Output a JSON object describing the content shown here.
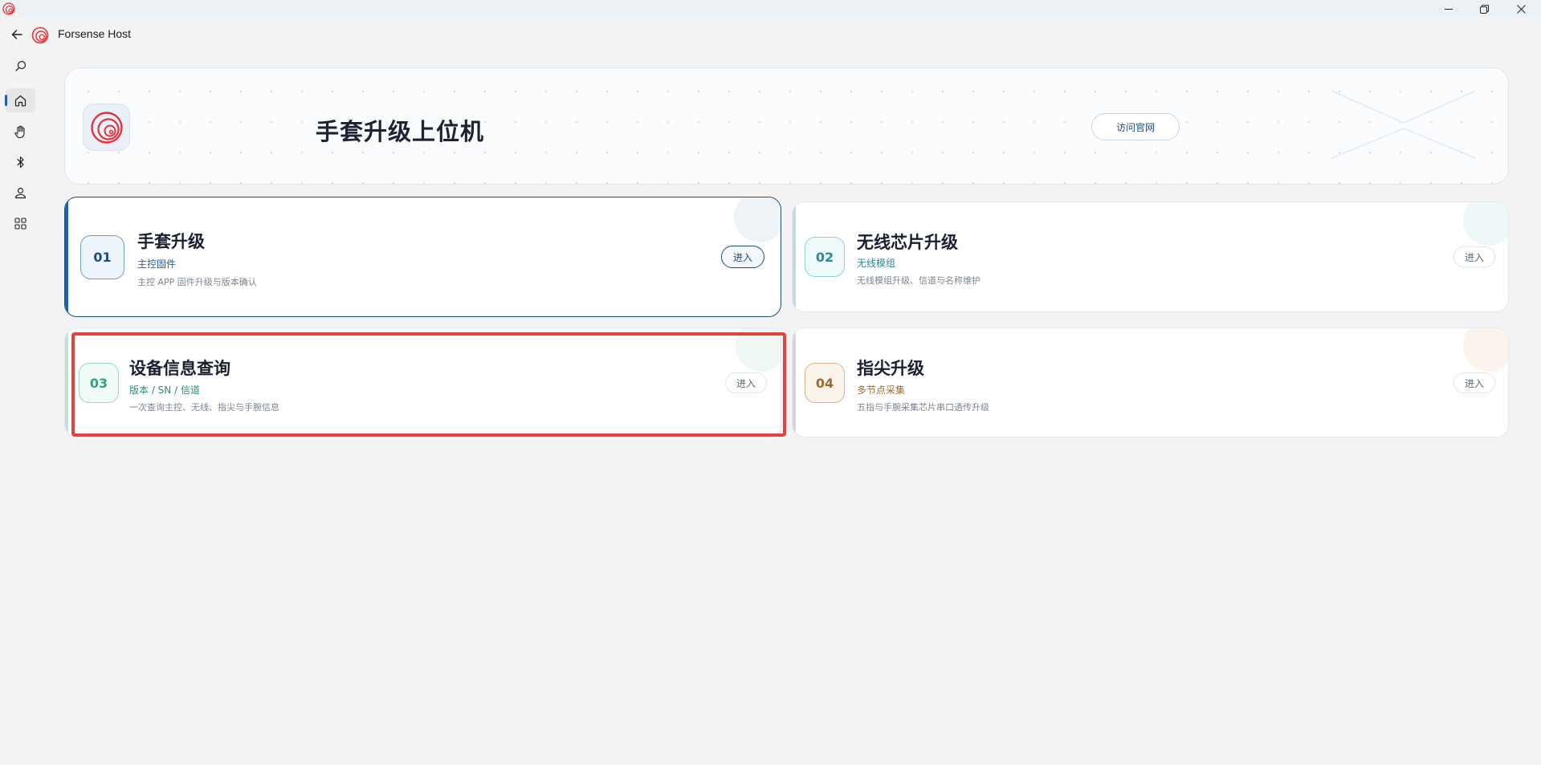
{
  "window": {
    "app_title": "Forsense Host"
  },
  "nav": {
    "items": [
      {
        "name": "search-icon"
      },
      {
        "name": "home-icon",
        "active": true
      },
      {
        "name": "hand-icon"
      },
      {
        "name": "bluetooth-icon"
      },
      {
        "name": "user-icon"
      },
      {
        "name": "apps-grid-icon"
      }
    ]
  },
  "hero": {
    "title": "手套升级上位机",
    "button_label": "访问官网"
  },
  "cards": [
    {
      "index": "01",
      "title": "手套升级",
      "subtitle": "主控固件",
      "description": "主控 APP 固件升级与版本确认",
      "enter_label": "进入",
      "accent": "#1f5fa8"
    },
    {
      "index": "02",
      "title": "无线芯片升级",
      "subtitle": "无线模组",
      "description": "无线模组升级、信道与名称维护",
      "enter_label": "进入",
      "accent": "#2a9aa8"
    },
    {
      "index": "03",
      "title": "设备信息查询",
      "subtitle": "版本 / SN / 信道",
      "description": "一次查询主控、无线、指尖与手腕信息",
      "enter_label": "进入",
      "accent": "#2aa37a"
    },
    {
      "index": "04",
      "title": "指尖升级",
      "subtitle": "多节点采集",
      "description": "五指与手腕采集芯片串口透传升级",
      "enter_label": "进入",
      "accent": "#a8793a"
    }
  ],
  "colors": {
    "highlight": "#e2433e",
    "brand_red": "#e5323a",
    "primary_blue": "#1f4d7a"
  }
}
